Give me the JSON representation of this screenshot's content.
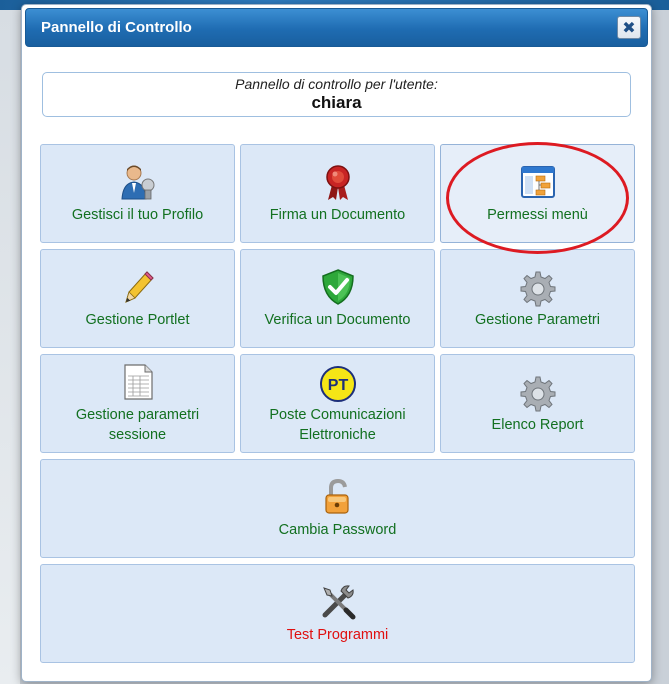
{
  "dialog": {
    "title": "Pannello di Controllo",
    "close_icon": "close-icon",
    "close_symbol": "✖"
  },
  "user": {
    "caption": "Pannello di controllo per l'utente:",
    "name": "chiara"
  },
  "tiles": [
    {
      "label": "Gestisci il tuo Profilo",
      "icon": "user-profile-icon"
    },
    {
      "label": "Firma un Documento",
      "icon": "seal-ribbon-icon"
    },
    {
      "label": "Permessi menù",
      "icon": "menu-window-icon"
    },
    {
      "label": "Gestione Portlet",
      "icon": "pencil-icon"
    },
    {
      "label": "Verifica un Documento",
      "icon": "shield-check-icon"
    },
    {
      "label": "Gestione Parametri",
      "icon": "gear-icon"
    },
    {
      "label_line1": "Gestione parametri",
      "label_line2": "sessione",
      "icon": "spreadsheet-icon"
    },
    {
      "label_line1": "Poste Comunicazioni",
      "label_line2": "Elettroniche",
      "icon": "pt-badge-icon",
      "badge_text": "PT"
    },
    {
      "label": "Elenco Report",
      "icon": "gear-icon"
    },
    {
      "label": "Cambia Password",
      "icon": "padlock-open-icon"
    },
    {
      "label": "Test Programmi",
      "icon": "tools-icon"
    }
  ],
  "colors": {
    "label_green": "#127020",
    "label_red": "#e01010",
    "tile_bg": "#dce8f7",
    "highlight_circle": "#dd1a22",
    "titlebar": "#1f6cb2"
  }
}
